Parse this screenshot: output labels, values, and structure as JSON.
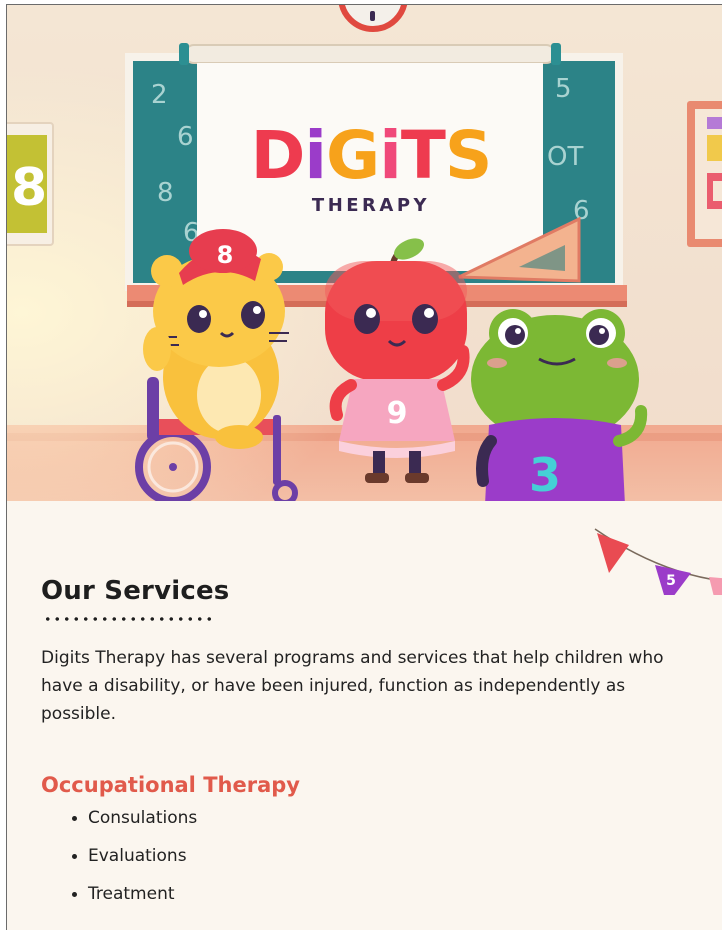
{
  "hero": {
    "brand_word": "DiGiTS",
    "brand_sub": "THERAPY",
    "chalkboard_left_numbers": [
      "2",
      "6",
      "8",
      "6"
    ],
    "chalkboard_right_numbers": [
      "5",
      "OT",
      "6"
    ],
    "wall_poster_number": "8",
    "hamster_cap_number": "8",
    "apple_shirt_number": "9",
    "frog_shirt_number": "3",
    "colors": {
      "brand_red": "#ee3b4f",
      "brand_purple": "#9b3cc9",
      "brand_orange": "#f7a21b",
      "brand_pink": "#f0497a",
      "brand_navy": "#3b2a52",
      "chalkboard": "#1f7c80"
    }
  },
  "bunting": {
    "flag_number": "5"
  },
  "services": {
    "heading": "Our Services",
    "intro": "Digits Therapy has several programs and services that help children who have a disability, or have been injured, function as independently as possible.",
    "ot_heading": "Occupational Therapy",
    "ot_items": [
      "Consulations",
      "Evaluations",
      "Treatment"
    ],
    "colors": {
      "accent": "#e15a4b",
      "text": "#222222",
      "background": "#fbf6ef"
    }
  }
}
